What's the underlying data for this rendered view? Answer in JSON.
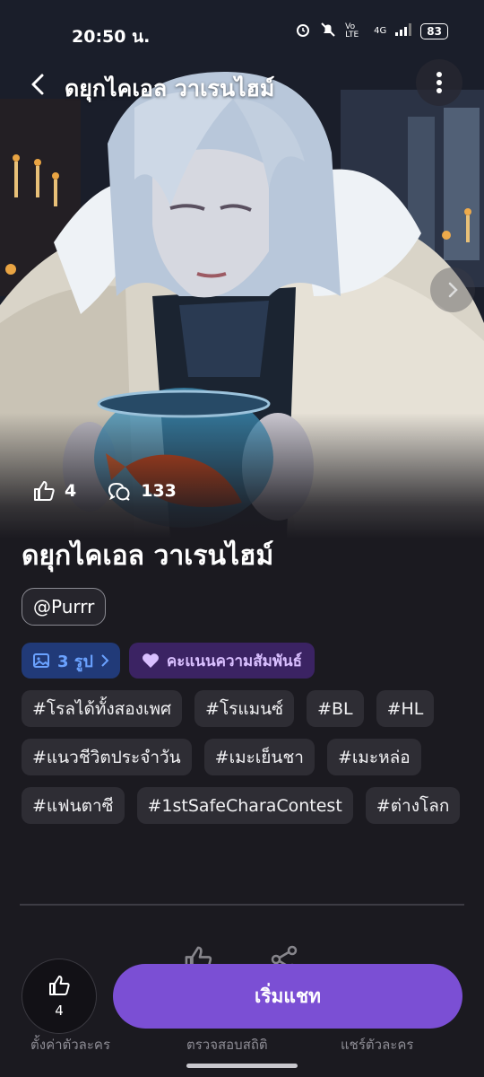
{
  "status_bar": {
    "time": "20:50 น.",
    "network": "4G",
    "volte": "Vo LTE",
    "battery": "83"
  },
  "header": {
    "title": "ดยุกไคเอล วาเรนไฮม์"
  },
  "hero": {
    "likes": "4",
    "comments": "133"
  },
  "character": {
    "name": "ดยุกไคเอล วาเรนไฮม์",
    "author": "@Purrr"
  },
  "chips": {
    "images_label": "3 รูป",
    "relationship_label": "คะแนนความสัมพันธ์"
  },
  "tags": [
    "#โรลได้ทั้งสองเพศ",
    "#โรแมนซ์",
    "#BL",
    "#HL",
    "#แนวชีวิตประจำวัน",
    "#เมะเย็นชา",
    "#เมะหล่อ",
    "#แฟนตาซี",
    "#1stSafeCharaContest",
    "#ต่างโลก"
  ],
  "ghost_actions": {
    "left": "ตั้งค่าตัวละคร",
    "middle": "ตรวจสอบสถิติ",
    "right": "แชร์ตัวละคร"
  },
  "bottom": {
    "like_count": "4",
    "start_chat": "เริ่มแชท"
  },
  "colors": {
    "accent": "#7b4fd4",
    "background": "#1b1a20",
    "chip_blue": "#213a78",
    "chip_purple": "#3b2363"
  }
}
